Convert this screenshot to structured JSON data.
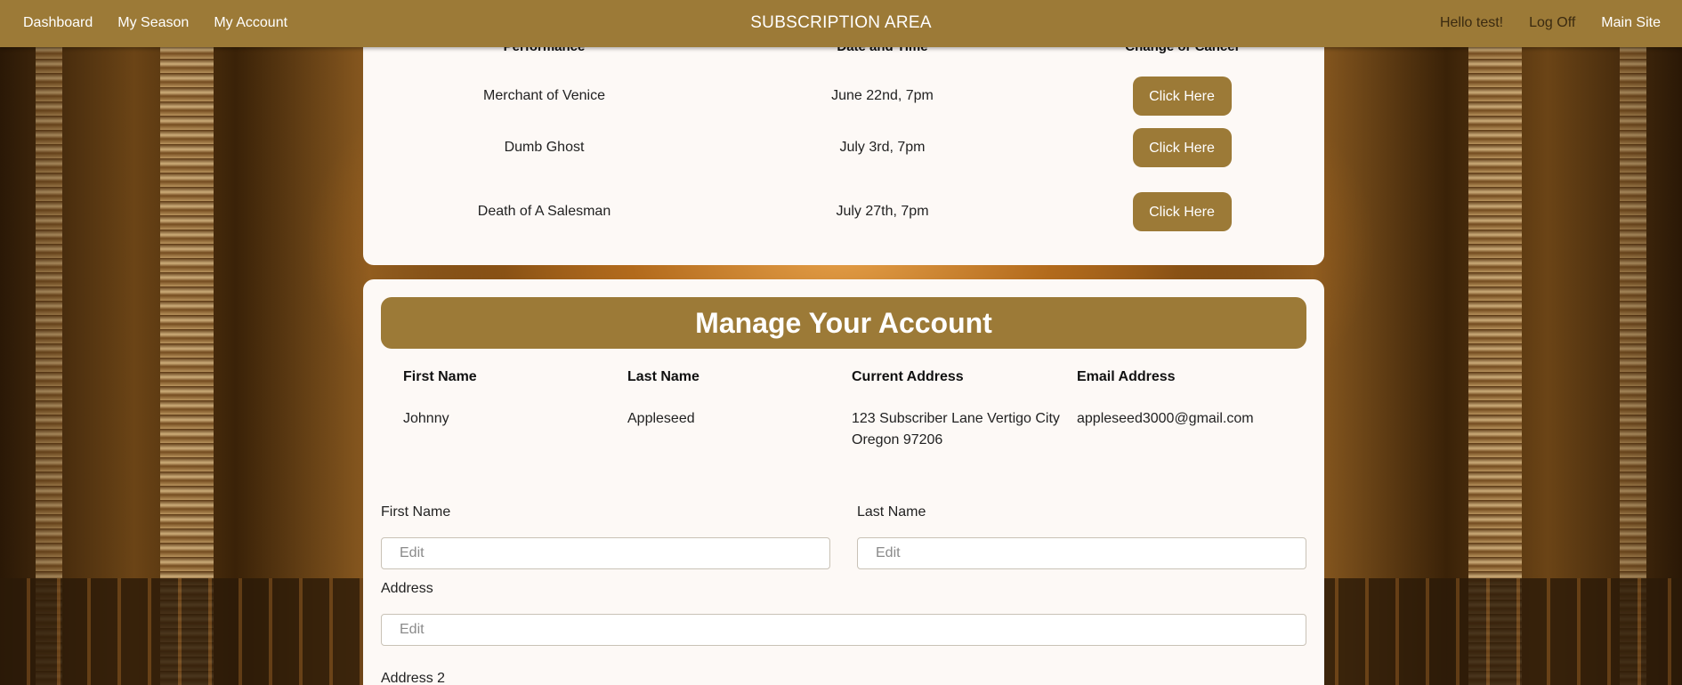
{
  "nav": {
    "links": [
      "Dashboard",
      "My Season",
      "My Account"
    ],
    "title": "SUBSCRIPTION AREA",
    "greeting": "Hello test!",
    "logoff": "Log Off",
    "main_site": "Main Site"
  },
  "performances": {
    "headers": [
      "Performance",
      "Date and Time",
      "Change or Cancel"
    ],
    "rows": [
      {
        "title": "Merchant of Venice",
        "date": "June 22nd, 7pm",
        "action": "Click Here"
      },
      {
        "title": "Dumb Ghost",
        "date": "July 3rd, 7pm",
        "action": "Click Here"
      },
      {
        "title": "Death of A Salesman",
        "date": "July 27th, 7pm",
        "action": "Click Here"
      }
    ]
  },
  "account": {
    "heading": "Manage Your Account",
    "columns": [
      "First Name",
      "Last Name",
      "Current Address",
      "Email Address"
    ],
    "values": {
      "first_name": "Johnny",
      "last_name": "Appleseed",
      "address": "123 Subscriber Lane Vertigo City Oregon 97206",
      "email": "appleseed3000@gmail.com"
    },
    "form": {
      "first_name_label": "First Name",
      "last_name_label": "Last Name",
      "address_label": "Address",
      "address2_label": "Address 2",
      "placeholder": "Edit"
    }
  },
  "colors": {
    "accent": "#9c7a37",
    "card": "#fdf9f6"
  }
}
